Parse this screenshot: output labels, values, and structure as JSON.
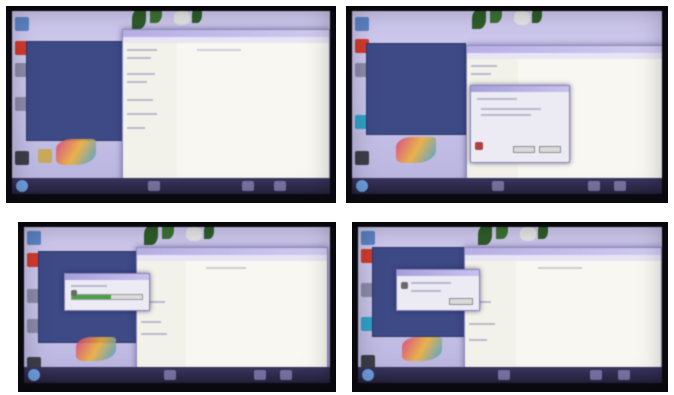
{
  "photos": [
    {
      "id": "top-left",
      "scene": "explorer-window",
      "dialog": "none"
    },
    {
      "id": "top-right",
      "scene": "explorer-with-dialog",
      "dialog": "dialog-with-buttons"
    },
    {
      "id": "bottom-left",
      "scene": "progress-dialog",
      "dialog": "progress",
      "progress_fraction": 0.55
    },
    {
      "id": "bottom-right",
      "scene": "small-dialog",
      "dialog": "small"
    }
  ],
  "colors": {
    "screen": "#c7c3e8",
    "explorer_bg": "#f6f6ef",
    "blue_panel": "#3d4a86",
    "taskbar": "#2f2a4d",
    "progress_fill": "#4aa04a"
  }
}
